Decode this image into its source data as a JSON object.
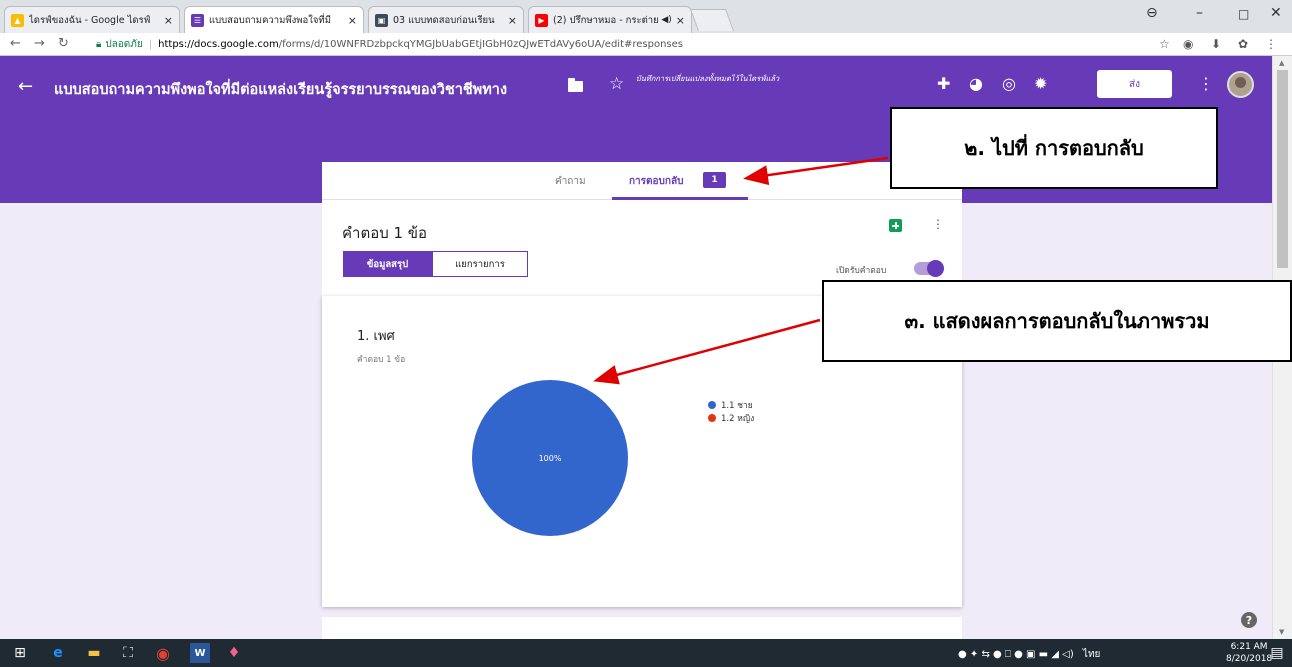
{
  "browser": {
    "tabs": [
      {
        "label": "ไดรฟ์ของฉัน - Google ไดรฟ์",
        "close": "×",
        "icon": "google-drive-icon",
        "color": "#fbbc04"
      },
      {
        "label": "แบบสอบถามความพึงพอใจที่มี",
        "close": "×",
        "icon": "google-forms-icon",
        "color": "#673ab7"
      },
      {
        "label": "03 แบบทดสอบก่อนเรียน",
        "close": "×",
        "icon": "image-icon",
        "color": "#3c4a5a"
      },
      {
        "label": "(2) ปรึกษาหมอ - กระต่าย",
        "close": "×",
        "icon": "youtube-icon",
        "color": "#ff0000"
      }
    ],
    "address": {
      "secure_label": "ปลอดภัย",
      "host": "https://docs.google.com",
      "path": "/forms/d/10WNFRDzbpckqYMGJbUabGEtjIGbH0zQJwETdAVy6oUA/edit#responses"
    }
  },
  "form": {
    "title": "แบบสอบถามความพึงพอใจที่มีต่อแหล่งเรียนรู้จรรยาบรรณของวิชาชีพทาง",
    "save_note": "บันทึกการเปลี่ยนแปลงทั้งหมดไว้ในไดรฟ์แล้ว",
    "send_label": "ส่ง",
    "brand_color": "#673ab7",
    "tabs": {
      "questions": "คำถาม",
      "responses": "การตอบกลับ",
      "badge": "1"
    }
  },
  "summary": {
    "count_label": "คำตอบ 1 ข้อ",
    "seg_summary": "ข้อมูลสรุป",
    "seg_individual": "แยกรายการ",
    "accepting_label": "เปิดรับคำตอบ",
    "accepting": true
  },
  "question": {
    "title": "1. เพศ",
    "subtitle": "คำตอบ 1 ข้อ"
  },
  "chart_data": {
    "type": "pie",
    "categories": [
      "1.1 ชาย",
      "1.2 หญิง"
    ],
    "values": [
      100,
      0
    ],
    "colors": [
      "#3366cc",
      "#dc3912"
    ],
    "slice_labels": [
      "100%",
      ""
    ],
    "legend_position": "right"
  },
  "annotations": {
    "callout2": "๒. ไปที่ การตอบกลับ",
    "callout3": "๓. แสดงผลการตอบกลับในภาพรวม"
  },
  "taskbar": {
    "language": "ไทย",
    "time": "6:21 AM",
    "date": "8/20/2018"
  }
}
